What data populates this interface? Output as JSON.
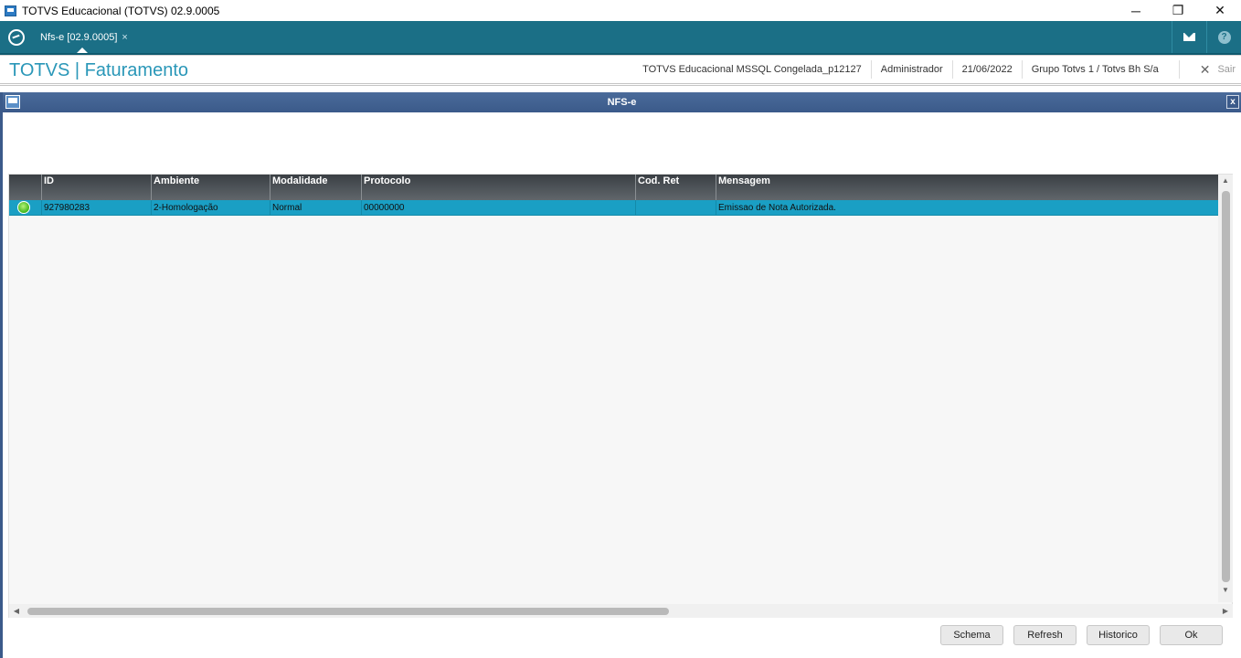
{
  "window": {
    "title": "TOTVS Educacional (TOTVS) 02.9.0005",
    "controls": {
      "minimize": "─",
      "restore": "❐",
      "close": "✕"
    }
  },
  "tabbar": {
    "active_tab_label": "Nfs-e [02.9.0005]",
    "tab_close": "×",
    "mail_icon": "mail-icon",
    "help_label": "?"
  },
  "module_header": {
    "title": "TOTVS | Faturamento",
    "environment": "TOTVS Educacional MSSQL Congelada_p12127",
    "user": "Administrador",
    "date": "21/06/2022",
    "company": "Grupo Totvs 1 / Totvs  Bh S/a",
    "exit_icon": "✕",
    "exit_label": "Sair"
  },
  "dialog": {
    "title": "NFS-e",
    "close_label": "x"
  },
  "grid": {
    "columns": [
      "",
      "ID",
      "Ambiente",
      "Modalidade",
      "Protocolo",
      "Cod. Ret",
      "Mensagem"
    ],
    "rows": [
      {
        "status": "green",
        "id": "927980283",
        "ambiente": "2-Homologação",
        "modalidade": "Normal",
        "protocolo": "00000000",
        "cod_ret": "",
        "mensagem": "Emissao de Nota Autorizada."
      }
    ],
    "status_color": "#3eb61b",
    "selected_row_color": "#1a9fc4",
    "scroll": {
      "up": "▲",
      "down": "▼",
      "left": "◀",
      "right": "▶"
    }
  },
  "buttons": {
    "schema": "Schema",
    "refresh": "Refresh",
    "historico": "Historico",
    "ok": "Ok"
  },
  "colors": {
    "tabbar": "#1b6f86",
    "accent_title": "#2a97b8",
    "dialog_title": "#3b5a8a"
  }
}
